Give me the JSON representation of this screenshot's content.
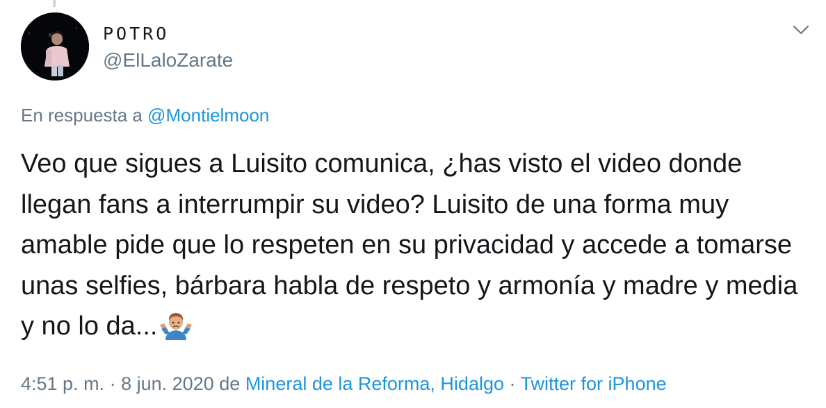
{
  "author": {
    "display_name": "POTRO",
    "handle": "@ElLaloZarate"
  },
  "reply": {
    "prefix": "En respuesta a",
    "mention": "@Montielmoon"
  },
  "tweet": {
    "text": "Veo que sigues a Luisito comunica, ¿has visto el video donde llegan fans a interrumpir su video? Luisito de una forma muy amable pide que lo respeten en su privacidad y accede a tomarse unas selfies, bárbara habla de respeto y armonía y madre y media y no lo da...",
    "emoji": "man-shrugging-icon"
  },
  "meta": {
    "time": "4:51 p. m.",
    "sep1": "·",
    "date": "8 jun. 2020",
    "from": "de",
    "location": "Mineral de la Reforma, Hidalgo",
    "sep2": "·",
    "source": "Twitter for iPhone"
  },
  "colors": {
    "text": "#14171a",
    "secondary": "#657786",
    "link": "#1b95e0",
    "background": "#ffffff"
  }
}
